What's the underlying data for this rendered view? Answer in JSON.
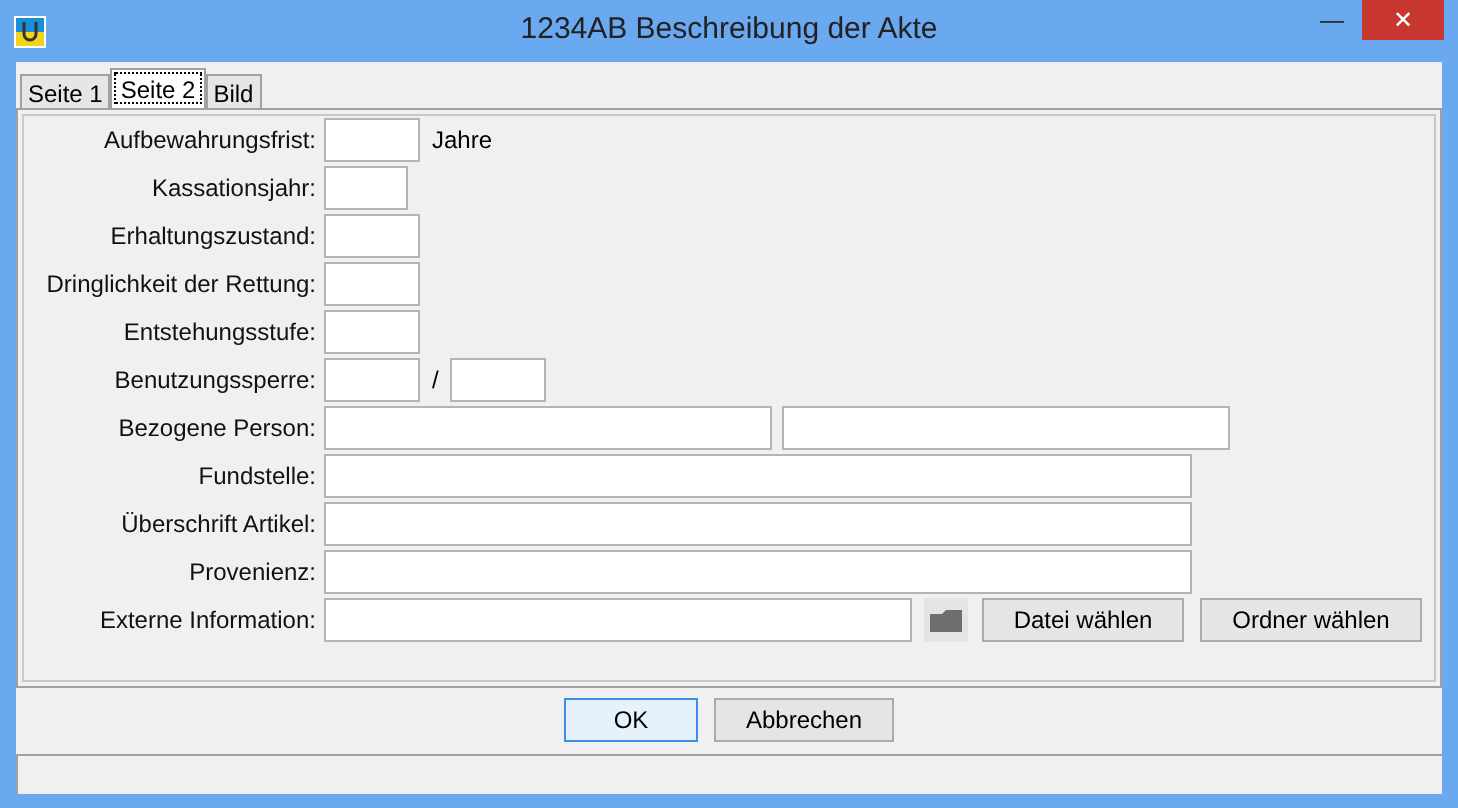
{
  "window": {
    "title": "1234AB Beschreibung der Akte",
    "buttons": [
      "—",
      "✕"
    ]
  },
  "tabs": [
    {
      "label": "Seite 1",
      "selected": false
    },
    {
      "label": "Seite 2",
      "selected": true
    },
    {
      "label": "Bild",
      "selected": false
    }
  ],
  "form": {
    "rows": [
      {
        "kind": "short",
        "label": "Aufbewahrungsfrist:",
        "suffix": "Jahre"
      },
      {
        "kind": "year",
        "label": "Kassationsjahr:"
      },
      {
        "kind": "short",
        "label": "Erhaltungszustand:"
      },
      {
        "kind": "short",
        "label": "Dringlichkeit der Rettung:"
      },
      {
        "kind": "short",
        "label": "Entstehungsstufe:"
      },
      {
        "kind": "pair",
        "label": "Benutzungssperre:",
        "separator": "/"
      },
      {
        "kind": "two",
        "label": "Bezogene Person:"
      },
      {
        "kind": "long",
        "label": "Fundstelle:"
      },
      {
        "kind": "long",
        "label": "Überschrift Artikel:"
      },
      {
        "kind": "long",
        "label": "Provenienz:"
      },
      {
        "kind": "file",
        "label": "Externe Information:",
        "buttons": [
          "Datei wählen",
          "Ordner wählen"
        ]
      }
    ]
  },
  "buttons": [
    {
      "label": "OK",
      "selected": true
    },
    {
      "label": "Abbrechen",
      "selected": false
    }
  ]
}
